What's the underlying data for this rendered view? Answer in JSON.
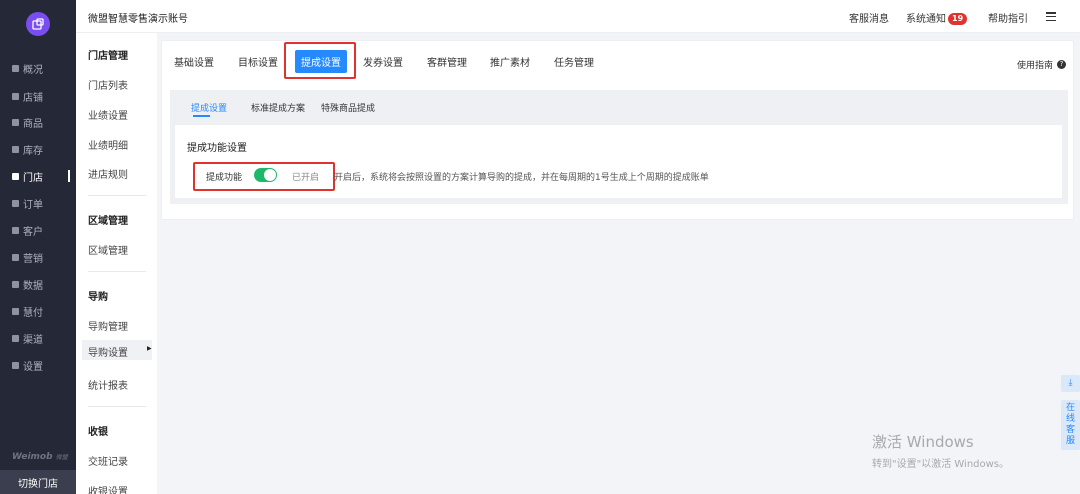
{
  "left_nav": {
    "items": [
      {
        "label": "概况",
        "icon": "overview-icon"
      },
      {
        "label": "店铺",
        "icon": "shop-icon"
      },
      {
        "label": "商品",
        "icon": "goods-icon"
      },
      {
        "label": "库存",
        "icon": "stock-icon"
      },
      {
        "label": "门店",
        "icon": "store-icon"
      },
      {
        "label": "订单",
        "icon": "order-icon"
      },
      {
        "label": "客户",
        "icon": "customer-icon"
      },
      {
        "label": "营销",
        "icon": "marketing-icon"
      },
      {
        "label": "数据",
        "icon": "data-icon"
      },
      {
        "label": "慧付",
        "icon": "pay-icon"
      },
      {
        "label": "渠道",
        "icon": "channel-icon"
      },
      {
        "label": "设置",
        "icon": "settings-icon"
      }
    ],
    "active": "门店",
    "brand": "Weimob",
    "brand_small": "微盟",
    "switch_store": "切换门店"
  },
  "topbar": {
    "account": "微盟智慧零售演示账号",
    "service_msg": "客服消息",
    "system_notice": "系统通知",
    "notice_count": "19",
    "help": "帮助指引"
  },
  "sub_nav": {
    "sections": [
      {
        "title": "门店管理",
        "items": [
          "门店列表",
          "业绩设置",
          "业绩明细",
          "进店规则"
        ]
      },
      {
        "title": "区域管理",
        "items": [
          "区域管理"
        ]
      },
      {
        "title": "导购",
        "items": [
          "导购管理",
          "导购设置",
          "统计报表"
        ]
      },
      {
        "title": "收银",
        "items": [
          "交班记录",
          "收银设置"
        ]
      }
    ],
    "selected": "导购设置"
  },
  "tabs": [
    "基础设置",
    "目标设置",
    "提成设置",
    "发券设置",
    "客群管理",
    "推广素材",
    "任务管理"
  ],
  "active_tab": "提成设置",
  "guide": "使用指南",
  "sub_tabs": [
    "提成设置",
    "标准提成方案",
    "特殊商品提成"
  ],
  "active_sub_tab": "提成设置",
  "card": {
    "title": "提成功能设置",
    "feature_label": "提成功能",
    "toggle_on": true,
    "toggle_state": "已开启",
    "hint": "开启后，系统将会按照设置的方案计算导购的提成，并在每周期的1号生成上个周期的提成账单"
  },
  "side_tools": {
    "online_service": "在线客服"
  },
  "watermark": {
    "line1": "激活 Windows",
    "line2": "转到\"设置\"以激活 Windows。"
  },
  "colors": {
    "accent": "#2589ff",
    "toggle": "#1db86a",
    "highlight": "#e0322e",
    "nav_bg": "#252836"
  }
}
